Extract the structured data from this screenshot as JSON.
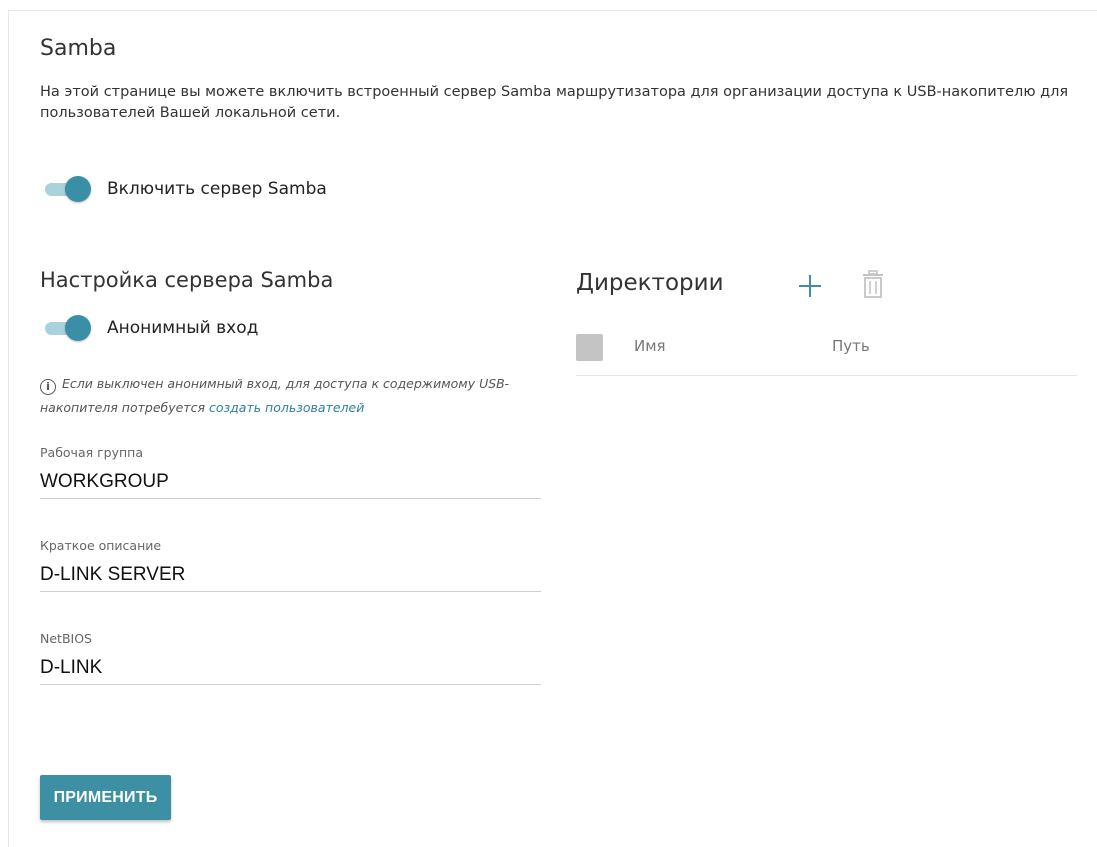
{
  "page": {
    "title": "Samba",
    "description": "На этой странице вы можете включить встроенный сервер Samba маршрутизатора для организации доступа к USB-накопителю для пользователей Вашей локальной сети."
  },
  "samba_toggle": {
    "label": "Включить сервер Samba",
    "enabled": true
  },
  "settings": {
    "title": "Настройка сервера Samba",
    "anonymous_toggle": {
      "label": "Анонимный вход",
      "enabled": true
    },
    "note": {
      "text": "Если выключен анонимный вход, для доступа к содержимому USB-накопителя потребуется",
      "link": "создать пользователей"
    },
    "fields": {
      "workgroup": {
        "label": "Рабочая группа",
        "value": "WORKGROUP"
      },
      "description": {
        "label": "Краткое описание",
        "value": "D-LINK SERVER"
      },
      "netbios": {
        "label": "NetBIOS",
        "value": "D-LINK"
      }
    },
    "apply_label": "ПРИМЕНИТЬ"
  },
  "directories": {
    "title": "Директории",
    "add_icon": "plus-icon",
    "delete_icon": "trash-icon",
    "columns": [
      "Имя",
      "Путь"
    ],
    "rows": []
  },
  "colors": {
    "accent": "#3d8fa3",
    "toggle_track": "#a9d2dc",
    "link": "#2f7ea5"
  }
}
